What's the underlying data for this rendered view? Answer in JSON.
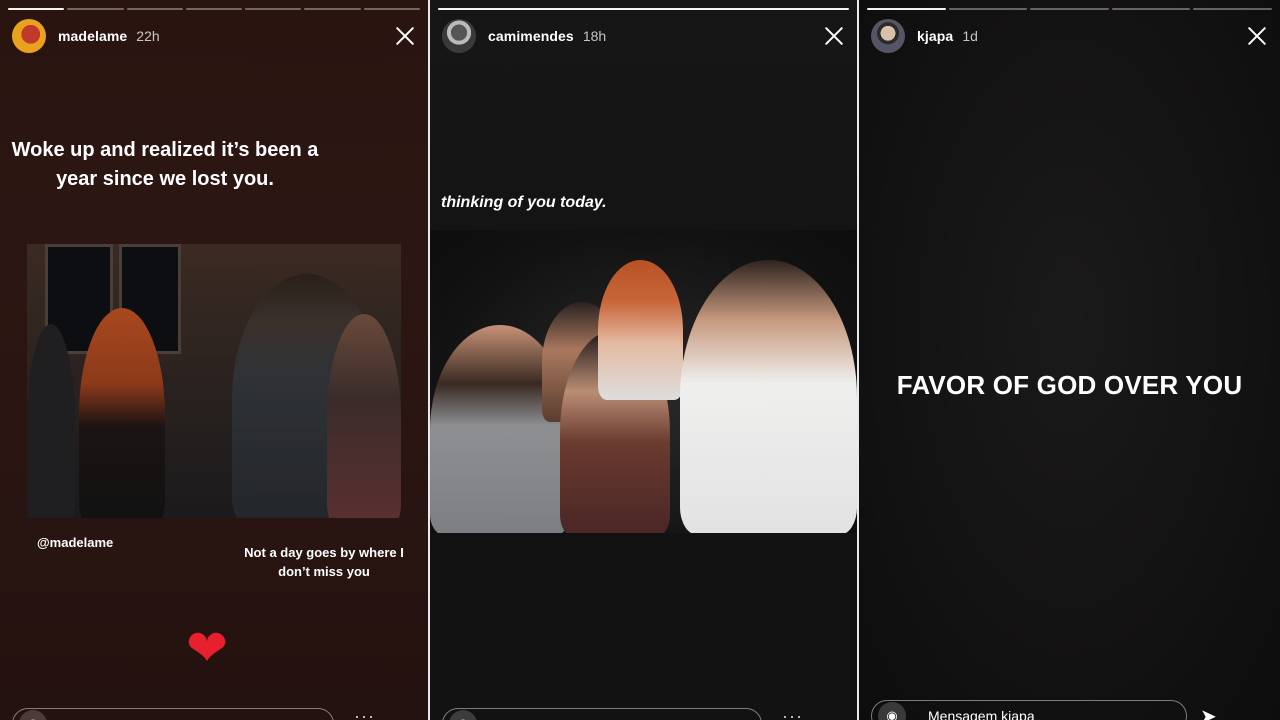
{
  "stories": [
    {
      "username": "madelame",
      "time": "22h",
      "caption": "Woke up and realized it’s been a year since we lost you.",
      "mention": "@madelame",
      "note": "Not a day goes by where I don’t miss you",
      "sticker": "❤"
    },
    {
      "username": "camimendes",
      "time": "18h",
      "caption": "thinking of you today."
    },
    {
      "username": "kjapa",
      "time": "1d",
      "caption": "FAVOR OF GOD OVER YOU",
      "reply_placeholder": "Mensagem kjapa"
    }
  ],
  "icons": {
    "close": "close-icon",
    "camera": "camera-icon",
    "send": "send-icon"
  },
  "colors": {
    "heart": "#e8202e",
    "story1_bg": "#2a1512",
    "story2_bg": "#131313",
    "story3_bg": "#121111"
  }
}
